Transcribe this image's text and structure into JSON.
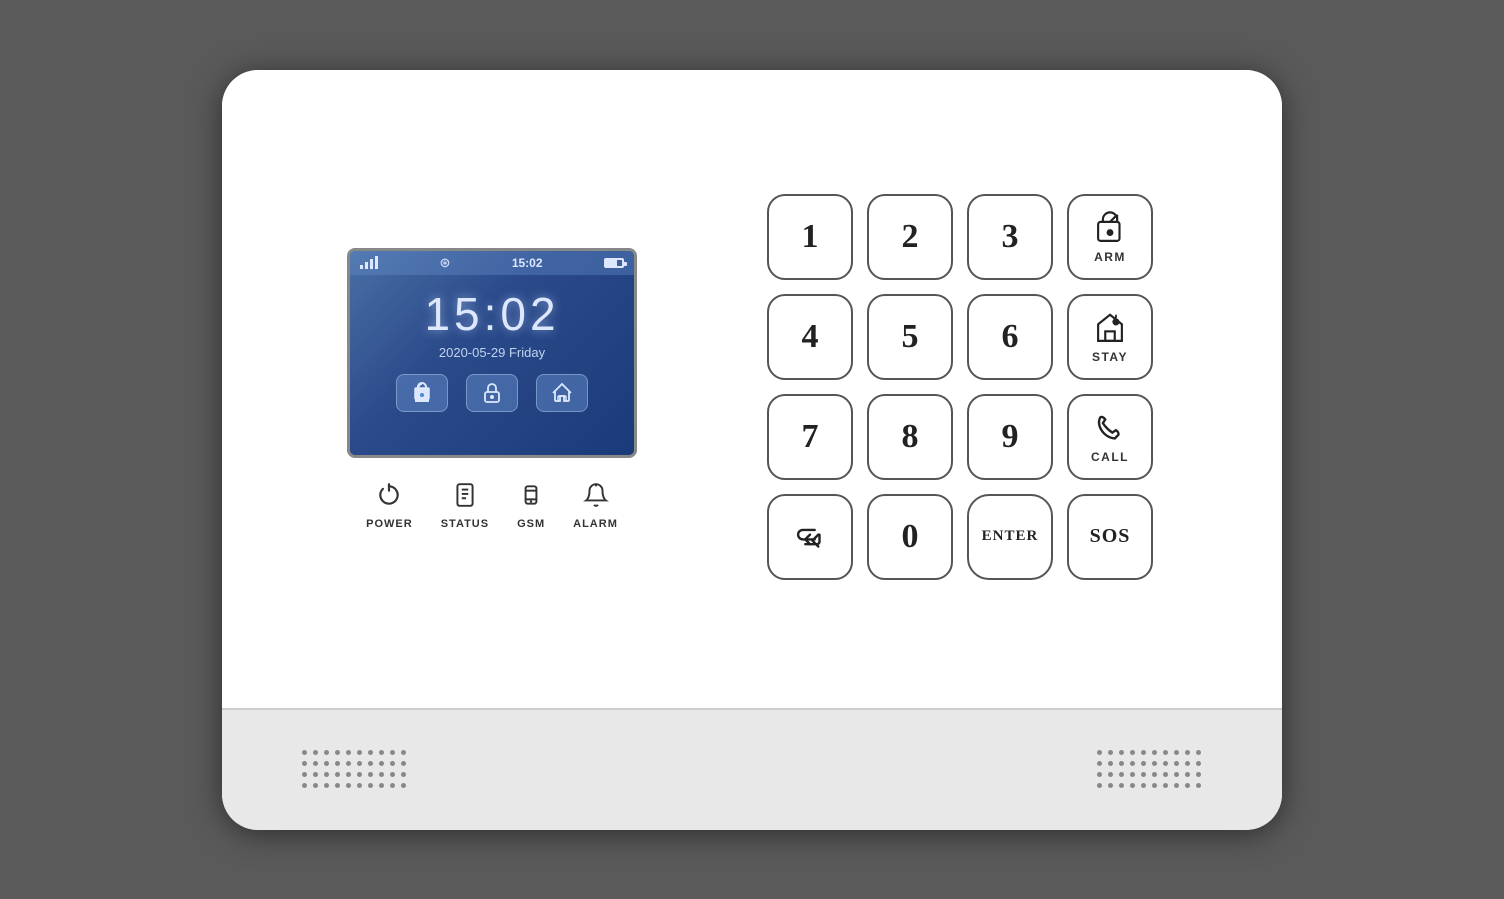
{
  "device": {
    "background_color": "#5a5a5a",
    "panel_color": "#ffffff",
    "bottom_color": "#e8e8e8"
  },
  "lcd": {
    "time": "15:02",
    "date": "2020-05-29 Friday",
    "status_time": "15:02"
  },
  "indicators": [
    {
      "id": "power",
      "label": "POWER",
      "icon": "⏻"
    },
    {
      "id": "status",
      "label": "STATUS",
      "icon": "📱"
    },
    {
      "id": "gsm",
      "label": "GSM",
      "icon": "📶"
    },
    {
      "id": "alarm",
      "label": "ALARM",
      "icon": "🔔"
    }
  ],
  "keypad": {
    "keys": [
      {
        "id": "1",
        "value": "1",
        "type": "number"
      },
      {
        "id": "2",
        "value": "2",
        "type": "number"
      },
      {
        "id": "3",
        "value": "3",
        "type": "number"
      },
      {
        "id": "arm",
        "value": "ARM",
        "type": "special"
      },
      {
        "id": "4",
        "value": "4",
        "type": "number"
      },
      {
        "id": "5",
        "value": "5",
        "type": "number"
      },
      {
        "id": "6",
        "value": "6",
        "type": "number"
      },
      {
        "id": "stay",
        "value": "STAY",
        "type": "special"
      },
      {
        "id": "7",
        "value": "7",
        "type": "number"
      },
      {
        "id": "8",
        "value": "8",
        "type": "number"
      },
      {
        "id": "9",
        "value": "9",
        "type": "number"
      },
      {
        "id": "call",
        "value": "CALL",
        "type": "special"
      },
      {
        "id": "back",
        "value": "⏎",
        "type": "func"
      },
      {
        "id": "0",
        "value": "0",
        "type": "number"
      },
      {
        "id": "enter",
        "value": "ENTER",
        "type": "func"
      },
      {
        "id": "sos",
        "value": "SOS",
        "type": "special"
      }
    ]
  }
}
